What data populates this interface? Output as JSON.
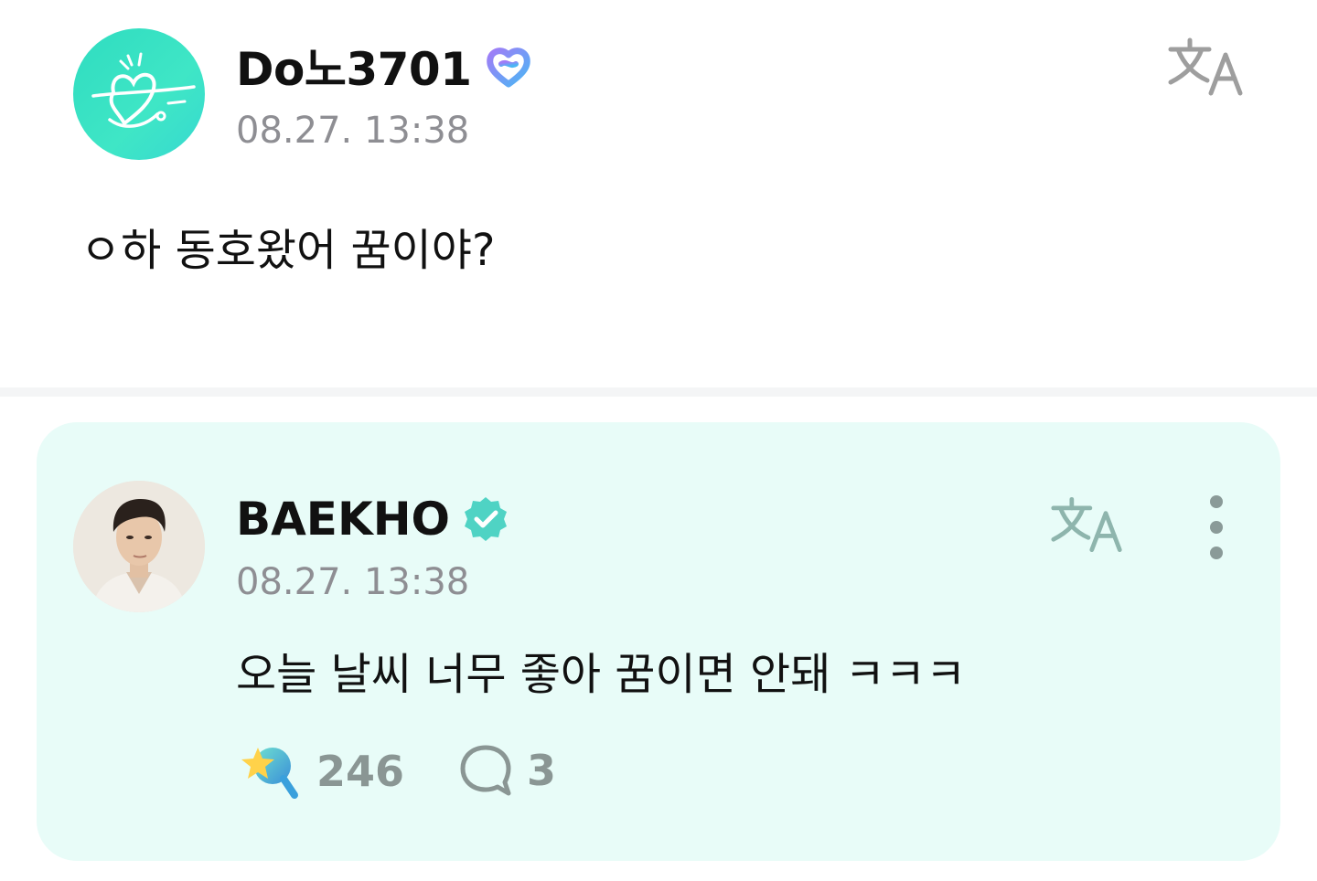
{
  "post": {
    "author": "Do노3701",
    "timestamp": "08.27. 13:38",
    "text": "ㅇ하 동호왔어 꿈이야?",
    "badge_icon": "fan-heart-badge-icon",
    "translate_icon": "translate-icon"
  },
  "reply": {
    "author": "BAEKHO",
    "timestamp": "08.27. 13:38",
    "text": "오늘 날씨 너무 좋아 꿈이면 안돼 ㅋㅋㅋ",
    "badge_icon": "verified-check-icon",
    "likes": "246",
    "comments": "3"
  },
  "colors": {
    "accent": "#4fd3c4",
    "card_bg": "#e8fcf8",
    "muted_text": "#8e8e93",
    "fan_badge": "#8a7cf2"
  }
}
